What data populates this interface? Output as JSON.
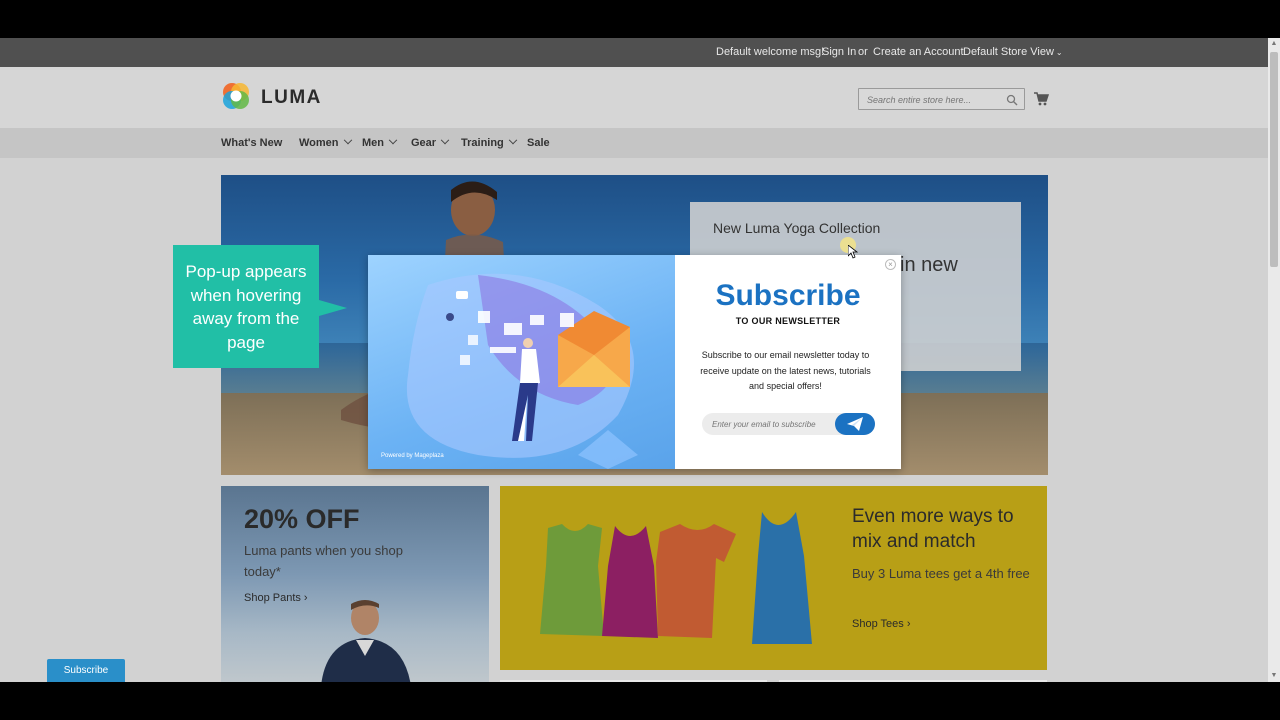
{
  "topbar": {
    "welcome": "Default welcome msg!",
    "sign_in": "Sign In",
    "or": "or",
    "create_account": "Create an Account",
    "store_view": "Default Store View"
  },
  "header": {
    "logo_text": "LUMA",
    "search_placeholder": "Search entire store here...",
    "search_icon": "search-icon",
    "cart_icon": "cart-icon"
  },
  "nav": {
    "items": [
      {
        "label": "What's New",
        "dropdown": false
      },
      {
        "label": "Women",
        "dropdown": true
      },
      {
        "label": "Men",
        "dropdown": true
      },
      {
        "label": "Gear",
        "dropdown": true
      },
      {
        "label": "Training",
        "dropdown": true
      },
      {
        "label": "Sale",
        "dropdown": false
      }
    ]
  },
  "hero": {
    "title": "New Luma Yoga Collection",
    "partial": "in new"
  },
  "popup": {
    "title": "Subscribe",
    "subtitle": "TO OUR NEWSLETTER",
    "description": "Subscribe to our email newsletter today to receive update on the latest news, tutorials and special offers!",
    "email_placeholder": "Enter your email to subscribe",
    "send_icon": "paper-plane-icon",
    "close_icon": "close-icon",
    "powered_by": "Powered by Mageplaza"
  },
  "callout": {
    "text": "Pop-up appears when hovering away from the page"
  },
  "promo_pants": {
    "headline": "20% OFF",
    "subtext": "Luma pants when you shop today*",
    "link": "Shop Pants"
  },
  "promo_tees": {
    "headline": "Even more ways to mix and match",
    "subtext": "Buy 3 Luma tees get a 4th free",
    "link": "Shop Tees"
  },
  "subscribe_tab": {
    "label": "Subscribe"
  },
  "colors": {
    "brand_blue": "#1b72c2",
    "callout_teal": "#21bfa6",
    "promo_yellow": "#b89f16",
    "tab_blue": "#2a8fc9"
  }
}
